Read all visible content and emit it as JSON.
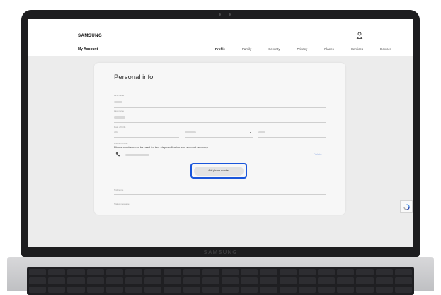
{
  "device": {
    "brand": "SAMSUNG"
  },
  "header": {
    "logo": "SAMSUNG",
    "section_title": "My Account",
    "tabs": [
      {
        "label": "Profile",
        "active": true
      },
      {
        "label": "Family"
      },
      {
        "label": "Security"
      },
      {
        "label": "Privacy"
      },
      {
        "label": "Places"
      },
      {
        "label": "Services"
      },
      {
        "label": "Devices"
      }
    ]
  },
  "card": {
    "title": "Personal info",
    "fields": {
      "first_name_label": "First name",
      "last_name_label": "Last name",
      "dob_label": "Date of birth",
      "phone_label": "Phone number",
      "nickname_label": "Nickname",
      "status_label": "Status message"
    },
    "phone_description": "Phone numbers can be used for two-step verification and account recovery.",
    "delete_label": "Delete",
    "add_phone_label": "Add phone number"
  },
  "colors": {
    "highlight": "#1a56db",
    "delete_link": "#9ab3e6",
    "screen_bg": "#ececec"
  }
}
